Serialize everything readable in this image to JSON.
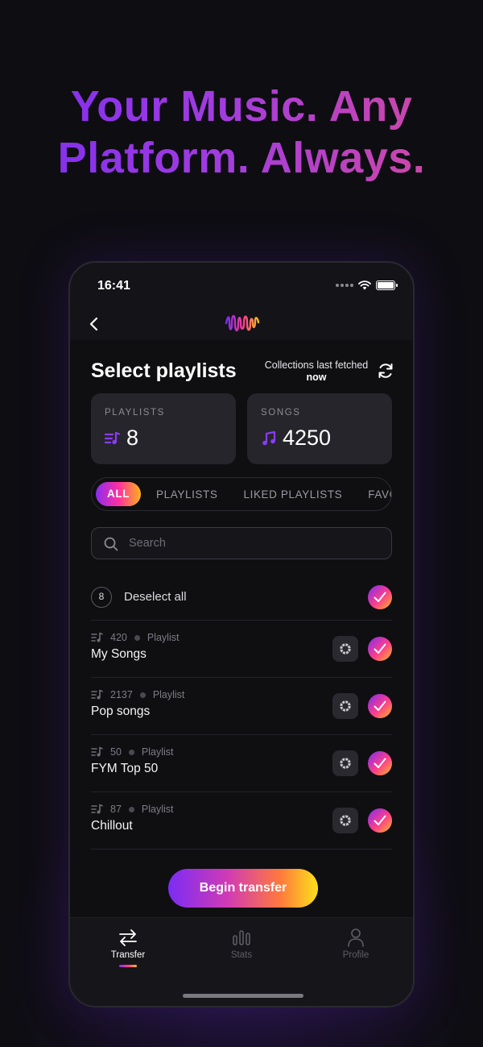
{
  "hero": {
    "line1": "Your Music. Any",
    "line2": "Platform. Always."
  },
  "status_bar": {
    "time": "16:41"
  },
  "header": {
    "title": "Select playlists",
    "fetched_label": "Collections last fetched",
    "fetched_value": "now"
  },
  "stats": {
    "playlists": {
      "label": "PLAYLISTS",
      "value": "8"
    },
    "songs": {
      "label": "SONGS",
      "value": "4250"
    }
  },
  "filters": [
    "ALL",
    "PLAYLISTS",
    "LIKED PLAYLISTS",
    "FAVO"
  ],
  "search": {
    "placeholder": "Search"
  },
  "select_all": {
    "count": "8",
    "label": "Deselect all"
  },
  "playlists": [
    {
      "count": "420",
      "type": "Playlist",
      "name": "My Songs"
    },
    {
      "count": "2137",
      "type": "Playlist",
      "name": "Pop songs"
    },
    {
      "count": "50",
      "type": "Playlist",
      "name": "FYM Top 50"
    },
    {
      "count": "87",
      "type": "Playlist",
      "name": "Chillout"
    }
  ],
  "cta": {
    "label": "Begin transfer"
  },
  "tabs": [
    {
      "label": "Transfer",
      "icon": "transfer-icon",
      "active": true
    },
    {
      "label": "Stats",
      "icon": "stats-icon",
      "active": false
    },
    {
      "label": "Profile",
      "icon": "profile-icon",
      "active": false
    }
  ],
  "colors": {
    "accent_purple": "#7b2cf5",
    "accent_pink": "#ff3d8a",
    "accent_yellow": "#ffe21a",
    "background": "#0e0d12"
  }
}
